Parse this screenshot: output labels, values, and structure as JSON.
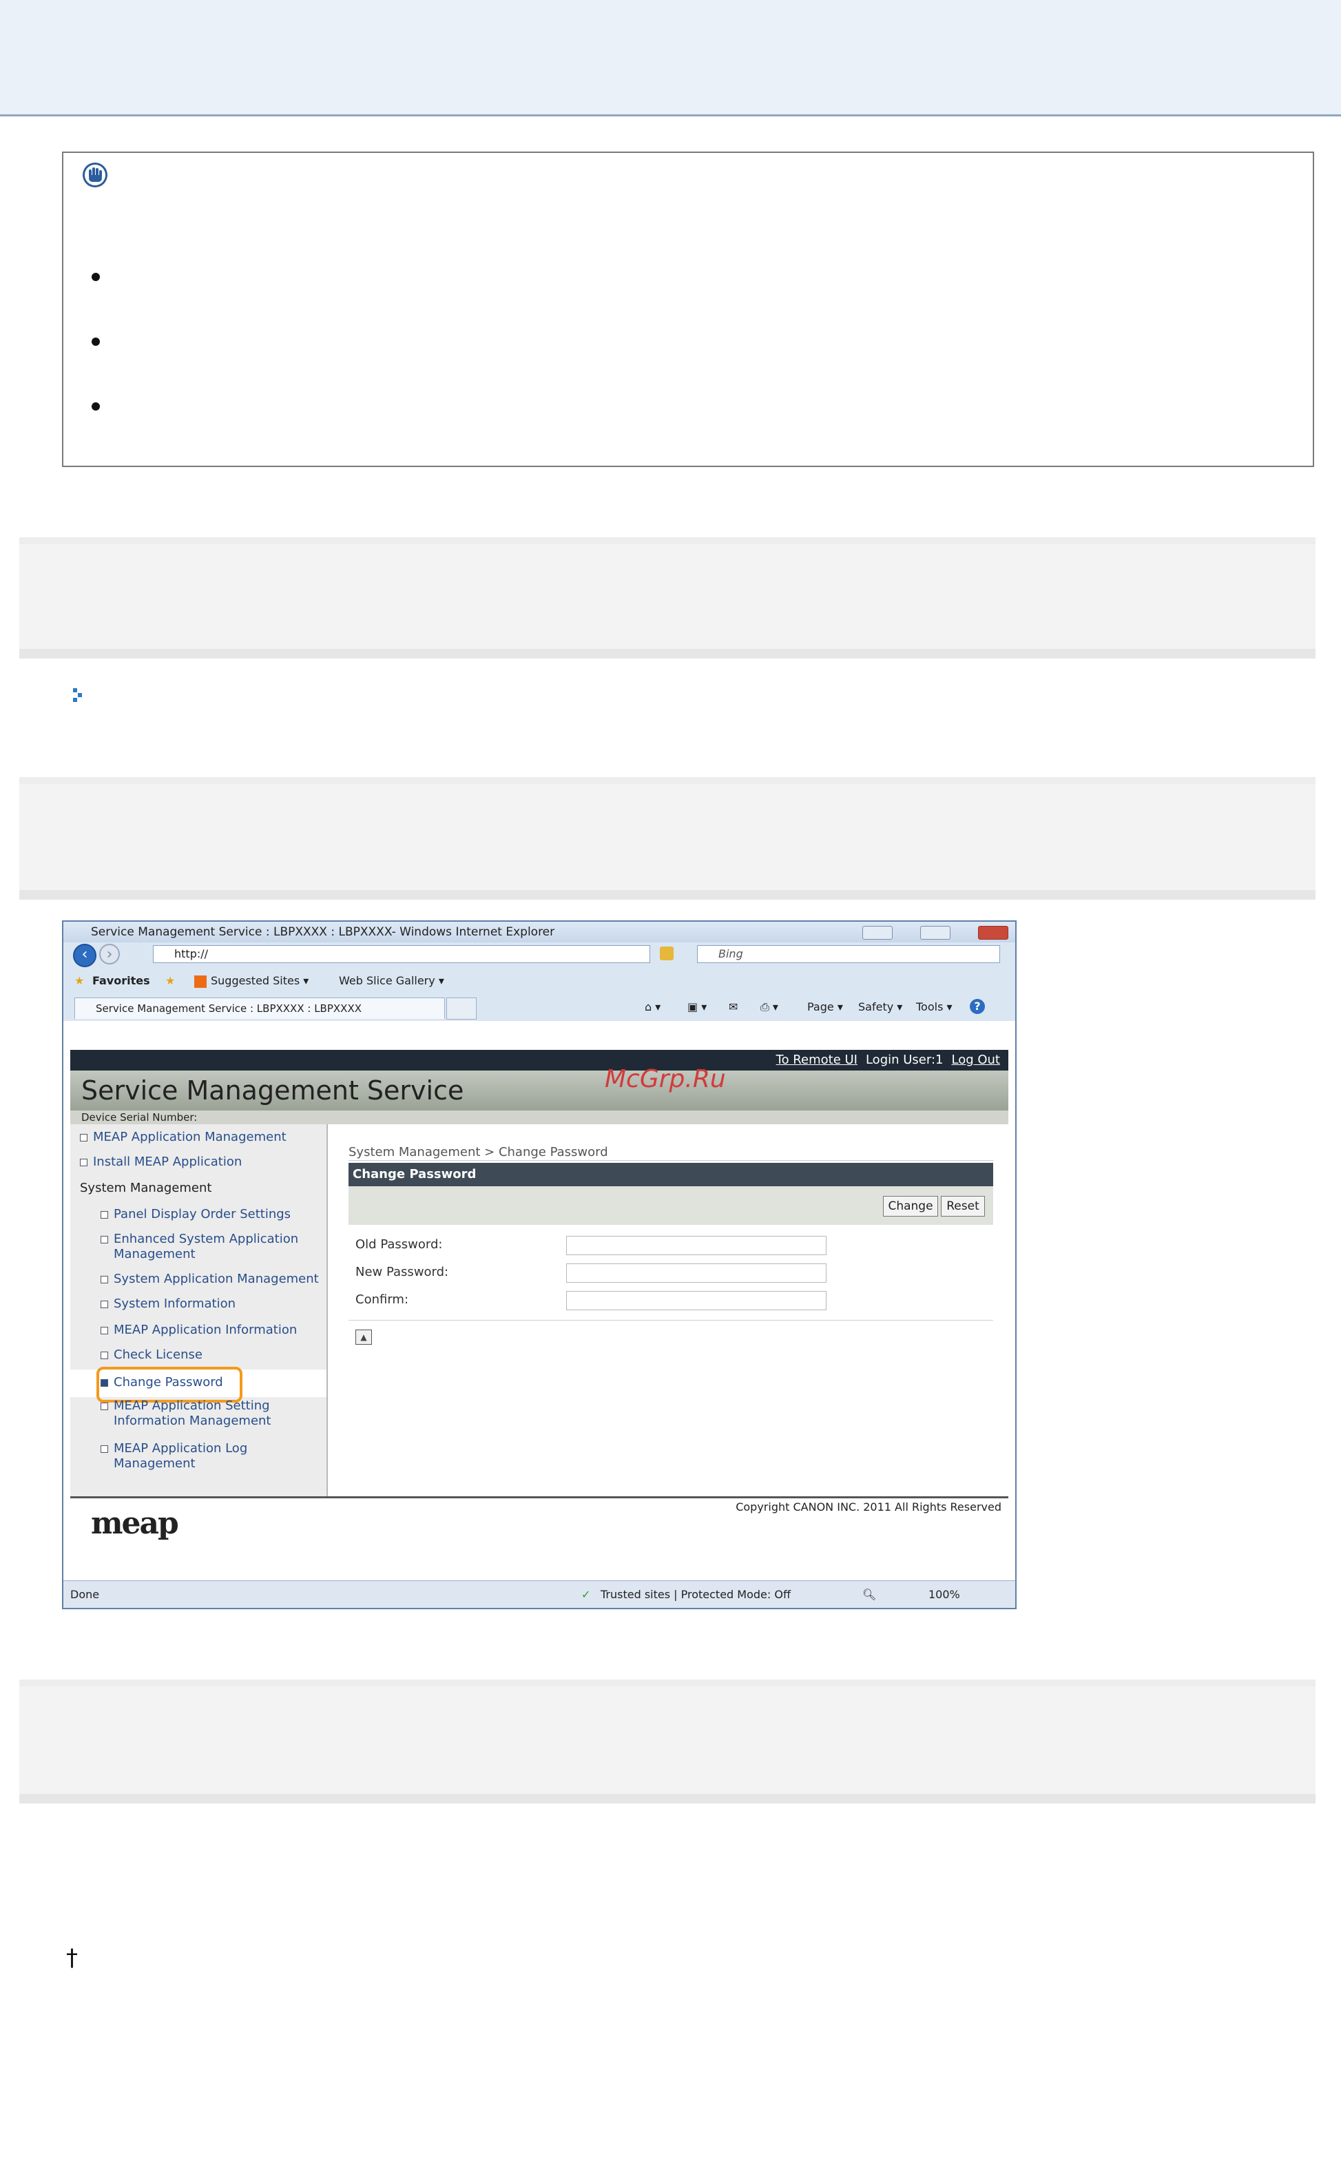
{
  "browser": {
    "window_title": "Service Management Service : LBPXXXX : LBPXXXX- Windows Internet Explorer",
    "address": "http://",
    "search_placeholder": "Bing",
    "favorites_label": "Favorites",
    "suggested_sites": "Suggested Sites ▾",
    "web_slice_gallery": "Web Slice Gallery ▾",
    "tab_title": "Service Management Service : LBPXXXX : LBPXXXX",
    "command_page": "Page ▾",
    "command_safety": "Safety ▾",
    "command_tools": "Tools ▾",
    "status_done": "Done",
    "status_zone": "Trusted sites | Protected Mode: Off",
    "status_zoom": "100%"
  },
  "sms": {
    "to_remote_ui": "To Remote UI",
    "login_user": "Login User:1",
    "logout": "Log Out",
    "title": "Service Management Service",
    "serial_label": "Device Serial Number:",
    "sidebar": {
      "items": [
        {
          "label": "MEAP Application Management"
        },
        {
          "label": "Install MEAP Application"
        },
        {
          "label": "System Management"
        },
        {
          "label": "Panel Display Order Settings"
        },
        {
          "label": "Enhanced System Application",
          "label2": "Management"
        },
        {
          "label": "System Application Management"
        },
        {
          "label": "System Information"
        },
        {
          "label": "MEAP Application Information"
        },
        {
          "label": "Check License"
        },
        {
          "label": "Change Password"
        },
        {
          "label": "MEAP Application Setting",
          "label2": "Information Management"
        },
        {
          "label": "MEAP Application Log",
          "label2": "Management"
        }
      ]
    },
    "breadcrumb": "System Management > Change Password",
    "panel_title": "Change Password",
    "change_button": "Change",
    "reset_button": "Reset",
    "old_password_label": "Old Password:",
    "new_password_label": "New Password:",
    "confirm_label": "Confirm:",
    "copyright": "Copyright CANON INC. 2011 All Rights Reserved",
    "logo_text": "meap"
  },
  "watermark": "McGrp.Ru",
  "dagger": "†"
}
